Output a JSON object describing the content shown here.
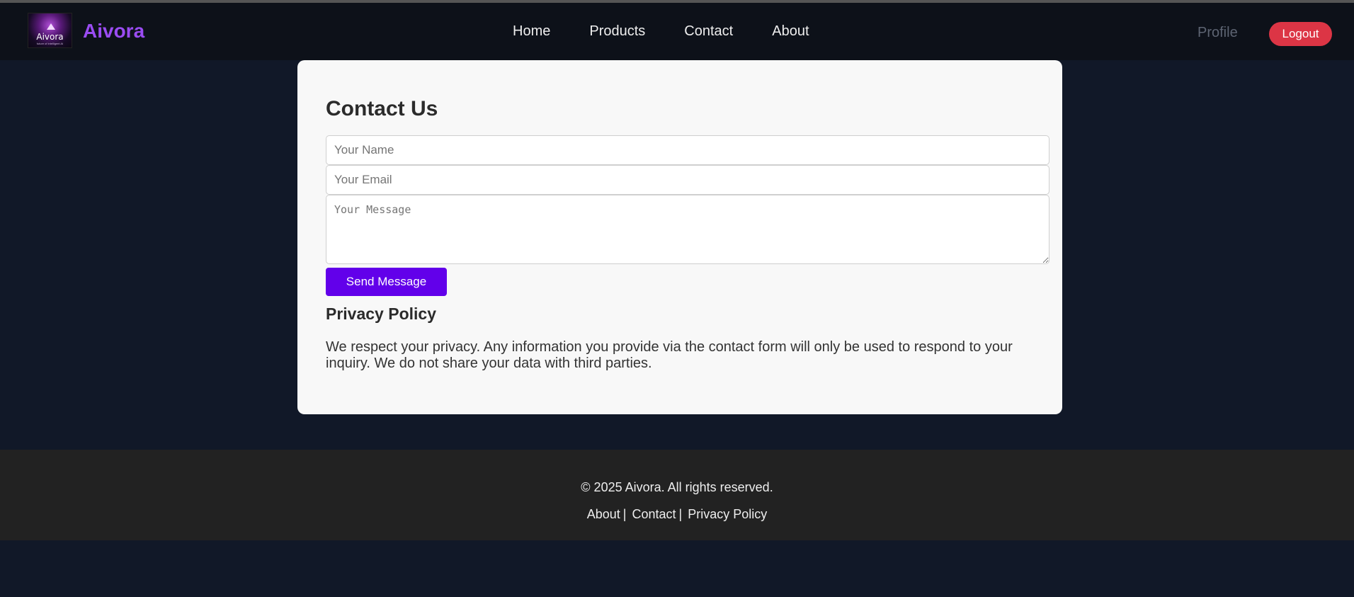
{
  "header": {
    "logo_text": "Aivora",
    "logo_tagline": "future of intelligent AI",
    "brand": "Aivora",
    "nav": [
      "Home",
      "Products",
      "Contact",
      "About"
    ],
    "profile": "Profile",
    "logout": "Logout"
  },
  "contact": {
    "title": "Contact Us",
    "name_placeholder": "Your Name",
    "email_placeholder": "Your Email",
    "message_placeholder": "Your Message",
    "send_label": "Send Message"
  },
  "privacy": {
    "title": "Privacy Policy",
    "text": "We respect your privacy. Any information you provide via the contact form will only be used to respond to your inquiry. We do not share your data with third parties."
  },
  "footer": {
    "copyright": "© 2025 Aivora. All rights reserved.",
    "links": [
      "About",
      "Contact",
      "Privacy Policy"
    ],
    "separator": "|"
  },
  "colors": {
    "brand": "#9a4cf2",
    "logout": "#dc3545",
    "send": "#6200ea",
    "background": "#111828"
  }
}
